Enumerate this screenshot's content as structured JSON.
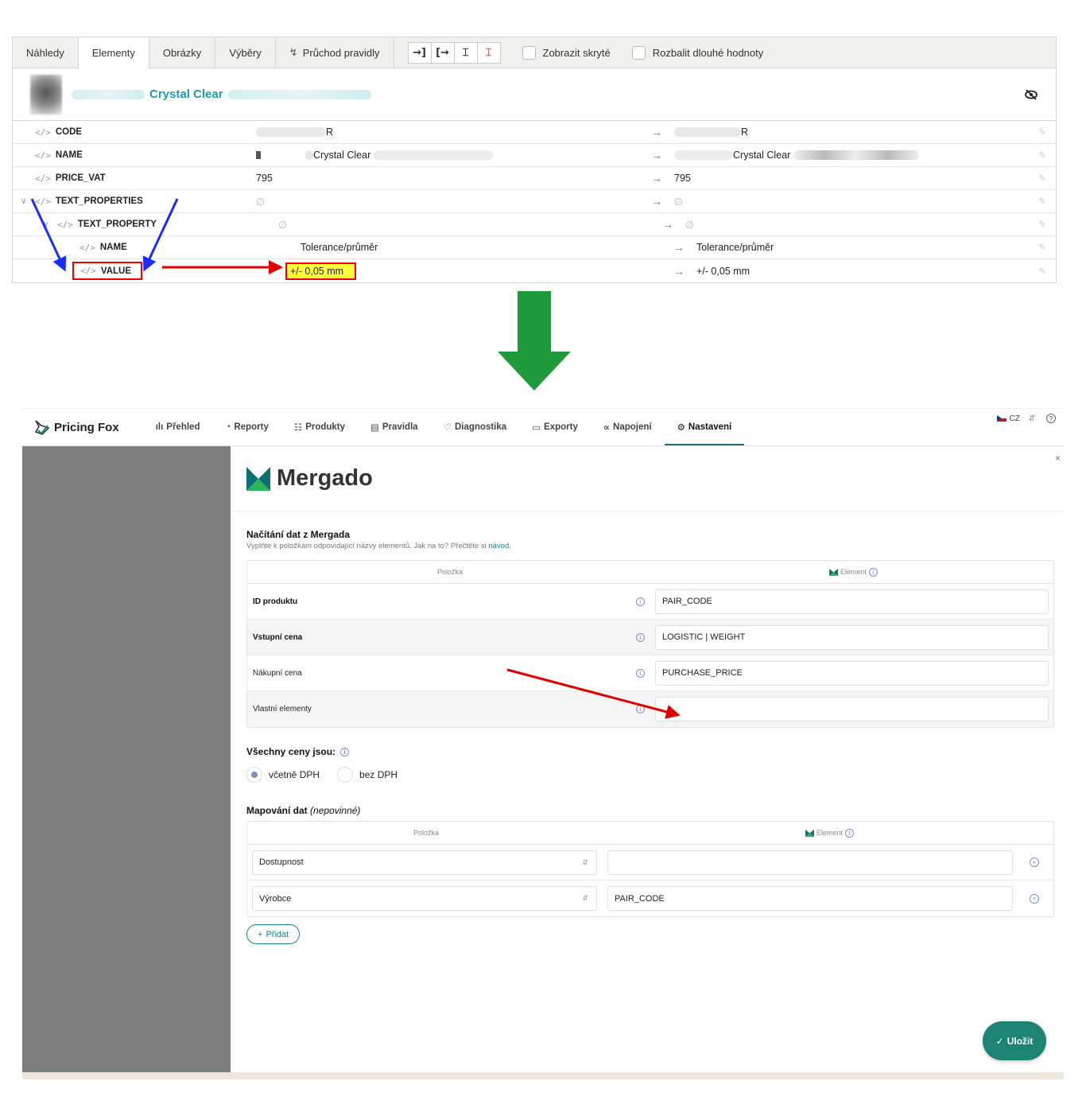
{
  "top_panel": {
    "tabs": [
      "Náhledy",
      "Elementy",
      "Obrázky",
      "Výběry"
    ],
    "active_tab": "Elementy",
    "rules_tab": "Průchod pravidly",
    "tools": [
      "→]",
      "[→",
      "⌶",
      "⌶"
    ],
    "checkbox_hidden": "Zobrazit skryté",
    "checkbox_long": "Rozbalit dlouhé hodnoty",
    "product_title": "Crystal Clear",
    "rows": [
      {
        "name": "CODE",
        "value": "R",
        "value2": "R"
      },
      {
        "name": "NAME",
        "value": "Crystal Clear",
        "value2": "Crystal Clear"
      },
      {
        "name": "PRICE_VAT",
        "value": "795",
        "value2": "795"
      },
      {
        "name": "TEXT_PROPERTIES",
        "value": "∅",
        "value2": "∅"
      },
      {
        "name": "TEXT_PROPERTY",
        "value": "∅",
        "value2": "∅"
      },
      {
        "name": "NAME",
        "value": "Tolerance/průměr",
        "value2": "Tolerance/průměr"
      },
      {
        "name": "VALUE",
        "value": "+/- 0,05 mm",
        "value2": "+/- 0,05 mm"
      }
    ],
    "code_icon": "</>",
    "arrow": "→"
  },
  "app": {
    "logo": "Pricing Fox",
    "nav": [
      {
        "label": "Přehled",
        "icon": "bar-chart-icon",
        "glyph": "ılı"
      },
      {
        "label": "Reporty",
        "icon": "clock-icon",
        "glyph": "◔"
      },
      {
        "label": "Produkty",
        "icon": "boxes-icon",
        "glyph": "☷"
      },
      {
        "label": "Pravidla",
        "icon": "list-icon",
        "glyph": "▤"
      },
      {
        "label": "Diagnostika",
        "icon": "stethoscope-icon",
        "glyph": "♡"
      },
      {
        "label": "Exporty",
        "icon": "inbox-icon",
        "glyph": "▭"
      },
      {
        "label": "Napojení",
        "icon": "share-icon",
        "glyph": "∝"
      },
      {
        "label": "Nastavení",
        "icon": "gear-icon",
        "glyph": "⚙"
      }
    ],
    "active_nav": "Nastavení",
    "lang": "CZ",
    "help": "?",
    "close": "×",
    "mergado_title": "Mergado",
    "load": {
      "title": "Načítání dat z Mergada",
      "subtitle": "Vyplňte k položkám odpovídající názvy elementů. Jak na to? Přečtěte si",
      "link": "návod",
      "col_item": "Položka",
      "col_element": "Element",
      "rows": [
        {
          "label": "ID produktu",
          "value": "PAIR_CODE"
        },
        {
          "label": "Vstupní cena",
          "value": "LOGISTIC | WEIGHT"
        },
        {
          "label": "Nákupní cena",
          "value": "PURCHASE_PRICE"
        },
        {
          "label": "Vlastní elementy",
          "value": ""
        }
      ]
    },
    "prices": {
      "title": "Všechny ceny jsou:",
      "options": [
        "včetně DPH",
        "bez DPH"
      ],
      "selected": "včetně DPH"
    },
    "mapping": {
      "title": "Mapování dat",
      "optional": "(nepovinné)",
      "col_item": "Položka",
      "col_element": "Element",
      "rows": [
        {
          "item": "Dostupnost",
          "element": ""
        },
        {
          "item": "Výrobce",
          "element": "PAIR_CODE"
        }
      ],
      "add_label": "Přidat"
    },
    "save_label": "Uložit"
  },
  "colors": {
    "highlight": "#ffff33",
    "annotation_red": "#e00000",
    "annotation_blue": "#1a2cff",
    "down_arrow": "#1f9a3a",
    "accent": "#1b8472"
  }
}
